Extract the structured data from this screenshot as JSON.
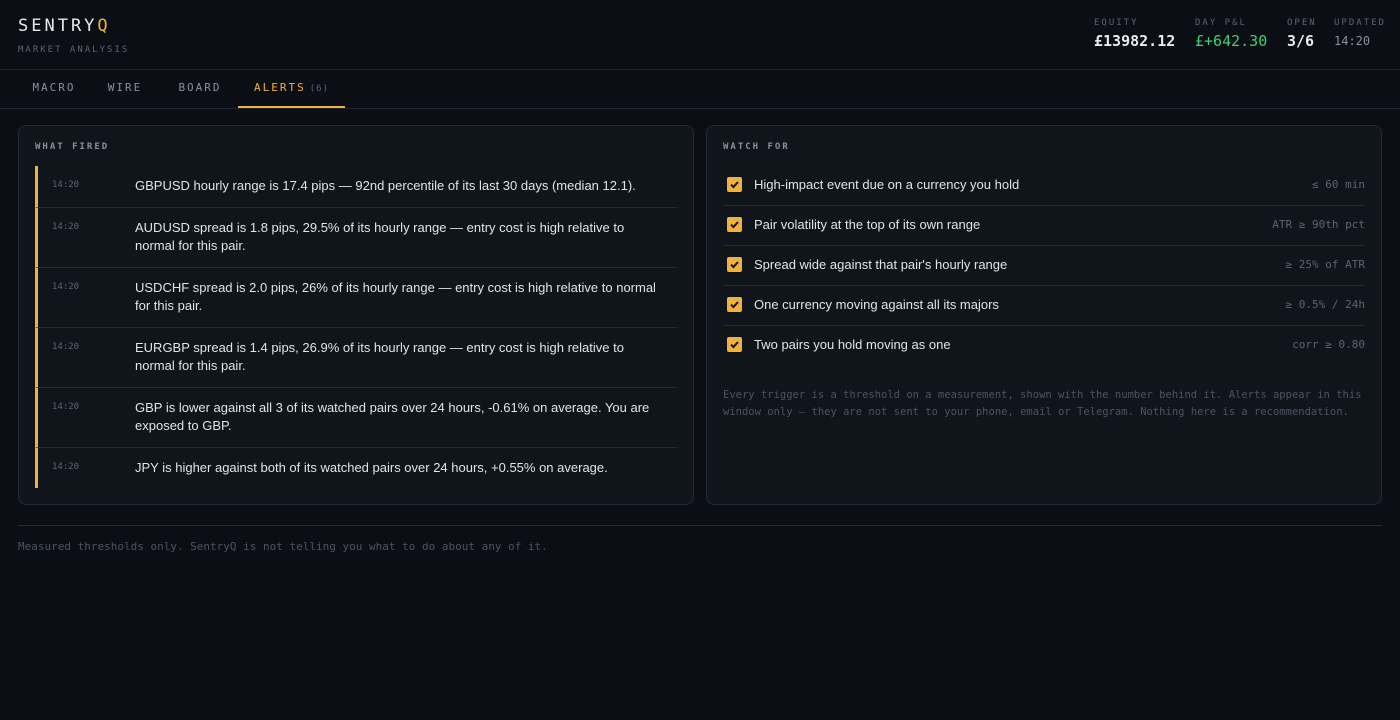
{
  "app": {
    "brand_main": "SENTRY",
    "brand_accent": "Q",
    "subtitle": "MARKET ANALYSIS"
  },
  "stats": {
    "equity": {
      "label": "EQUITY",
      "value": "£13982.12"
    },
    "day_pnl": {
      "label": "DAY P&L",
      "value": "£+642.30"
    },
    "open": {
      "label": "OPEN",
      "value": "3/6"
    },
    "updated": {
      "label": "UPDATED",
      "value": "14:20"
    }
  },
  "tabs": [
    {
      "label": "MACRO"
    },
    {
      "label": "WIRE"
    },
    {
      "label": "BOARD"
    },
    {
      "label": "ALERTS",
      "count": "(6)",
      "active": true
    }
  ],
  "fired": {
    "title": "WHAT FIRED",
    "items": [
      {
        "time": "14:20",
        "text": "GBPUSD hourly range is 17.4 pips — 92nd percentile of its last 30 days (median 12.1)."
      },
      {
        "time": "14:20",
        "text": "AUDUSD spread is 1.8 pips, 29.5% of its hourly range — entry cost is high relative to normal for this pair."
      },
      {
        "time": "14:20",
        "text": "USDCHF spread is 2.0 pips, 26% of its hourly range — entry cost is high relative to normal for this pair."
      },
      {
        "time": "14:20",
        "text": "EURGBP spread is 1.4 pips, 26.9% of its hourly range — entry cost is high relative to normal for this pair."
      },
      {
        "time": "14:20",
        "text": "GBP is lower against all 3 of its watched pairs over 24 hours, -0.61% on average. You are exposed to GBP."
      },
      {
        "time": "14:20",
        "text": "JPY is higher against both of its watched pairs over 24 hours, +0.55% on average."
      }
    ]
  },
  "watch": {
    "title": "WATCH FOR",
    "items": [
      {
        "label": "High-impact event due on a currency you hold",
        "threshold": "≤ 60 min",
        "checked": true
      },
      {
        "label": "Pair volatility at the top of its own range",
        "threshold": "ATR ≥ 90th pct",
        "checked": true
      },
      {
        "label": "Spread wide against that pair's hourly range",
        "threshold": "≥ 25% of ATR",
        "checked": true
      },
      {
        "label": "One currency moving against all its majors",
        "threshold": "≥ 0.5% / 24h",
        "checked": true
      },
      {
        "label": "Two pairs you hold moving as one",
        "threshold": "corr ≥ 0.80",
        "checked": true
      }
    ],
    "note": "Every trigger is a threshold on a measurement, shown with the number behind it. Alerts appear in this window only — they are not sent to your phone, email or Telegram. Nothing here is a recommendation."
  },
  "footer": {
    "text": "Measured thresholds only. SentryQ is not telling you what to do about any of it."
  },
  "colors": {
    "accent": "#f2b13c",
    "positive": "#3ecf75",
    "background": "#0b0e14",
    "panel": "#10141b"
  }
}
